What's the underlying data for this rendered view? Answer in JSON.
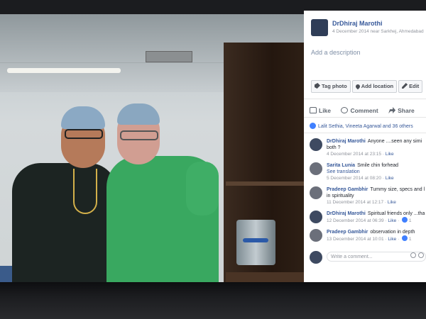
{
  "post": {
    "author": "DrDhiraj Marothi",
    "meta": "4 December 2014 near Sarkhej, Ahmedabad",
    "add_description": "Add a description",
    "buttons": {
      "tag": "Tag photo",
      "location": "Add location",
      "edit": "Edit"
    },
    "actions": {
      "like": "Like",
      "comment": "Comment",
      "share": "Share"
    },
    "reactions": "Lalit Sethia, Vineeta Agarwal and 36 others"
  },
  "comments": [
    {
      "name": "DrDhiraj Marothi",
      "text": "Anyone ....seen any simi",
      "cont": "both ?",
      "meta": "4 December 2014 at 23:15",
      "like": "Like"
    },
    {
      "name": "Sarita Lunia",
      "text": "Smile chin forhead",
      "link": "See translation",
      "meta": "5 December 2014 at 08:20",
      "like": "Like"
    },
    {
      "name": "Pradeep Gambhir",
      "text": "Tummy size, specs and l",
      "cont": "in spirituality",
      "meta": "11 December 2014 at 12:17",
      "like": "Like"
    },
    {
      "name": "DrDhiraj Marothi",
      "text": "Spiritual friends only ...tha",
      "meta": "12 December 2014 at 06:39",
      "like": "Like",
      "count": "1"
    },
    {
      "name": "Pradeep Gambhir",
      "text": "observation in depth",
      "meta": "13 December 2014 at 10:01",
      "like": "Like",
      "count": "1"
    }
  ],
  "write_comment_placeholder": "Write a comment...",
  "colors": {
    "link": "#365899",
    "accent": "#4080ff",
    "scrub_green": "#39a860"
  }
}
